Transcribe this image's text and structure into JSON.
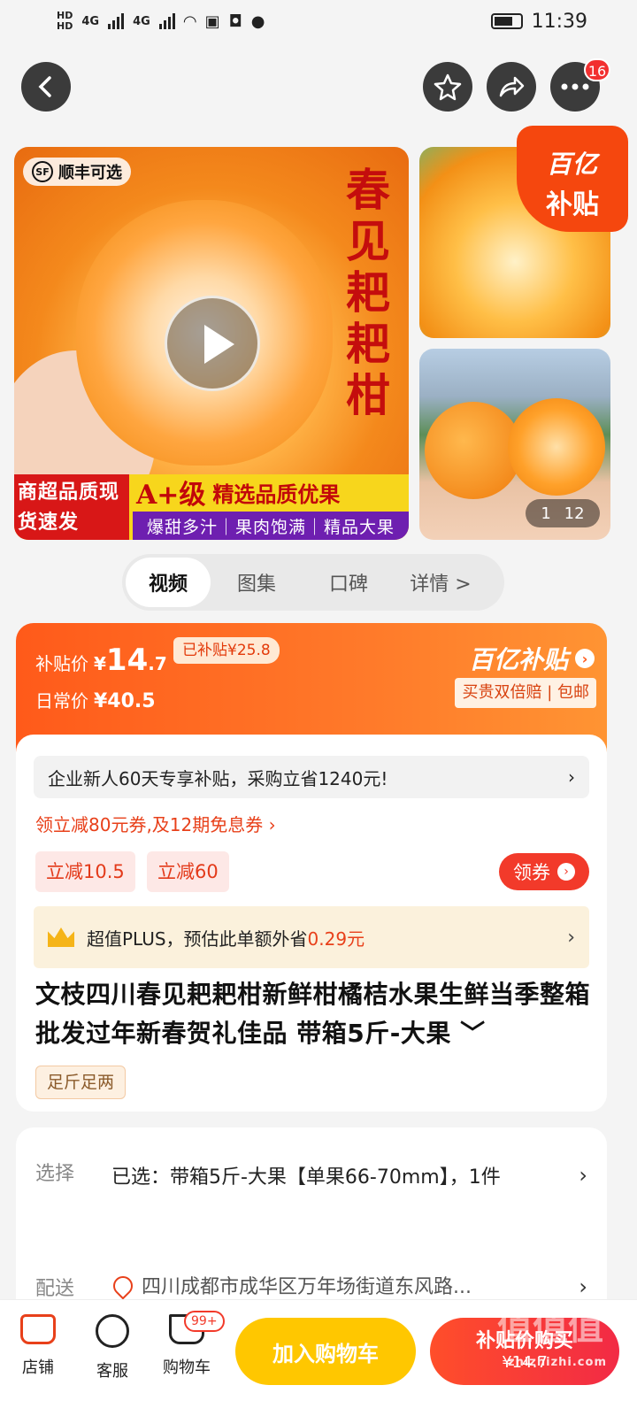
{
  "status_bar": {
    "time": "11:39",
    "network": "4G",
    "hd1": "HD",
    "hd2": "HD"
  },
  "nav": {
    "cart_badge": "16"
  },
  "gallery": {
    "sf_label": "顺丰可选",
    "sf_icon_text": "SF",
    "vertical_title": "春见耙耙柑",
    "banner_left": "商超品质现货速发",
    "banner_grade": "A+级",
    "banner_grade_text": "精选品质优果",
    "banner_bottom": "爆甜多汁｜果肉饱满｜精品大果",
    "subsidy_badge_l1": "百亿",
    "subsidy_badge_l2": "补贴",
    "counter_current": "1",
    "counter_total": "12"
  },
  "tabs": [
    {
      "label": "视频"
    },
    {
      "label": "图集"
    },
    {
      "label": "口碑"
    },
    {
      "label": "详情 >"
    }
  ],
  "price": {
    "subsidy_label": "补贴价",
    "currency": "¥",
    "subsidy_int": "14",
    "subsidy_dec": ".7",
    "subsidized_tag": "已补贴¥25.8",
    "regular_label": "日常价",
    "regular_price": "¥40.5",
    "brand": "百亿补贴",
    "promise": "买贵双倍赔 | 包邮"
  },
  "promo": {
    "new_user": "企业新人60天专享补贴，采购立省1240元!",
    "coupon_line": "领立减80元券,及12期免息券 ›",
    "chip1": "立减10.5",
    "chip2": "立减60",
    "get_coupon": "领券",
    "plus_text": "超值PLUS，预估此单额外省",
    "plus_amount": "0.29元"
  },
  "product": {
    "title": "文枝四川春见耙耙柑新鲜柑橘桔水果生鲜当季整箱批发过年新春贺礼佳品 带箱5斤-大果 ﹀",
    "tag": "足斤足两"
  },
  "options": {
    "select_label": "选择",
    "selected": "已选：带箱5斤-大果【单果66-70mm】，1件",
    "delivery_label": "配送",
    "address": "四川成都市成华区万年场街道东风路..."
  },
  "bottom_bar": {
    "store": "店铺",
    "service": "客服",
    "cart": "购物车",
    "cart_badge": "99+",
    "add_to_cart": "加入购物车",
    "buy_now": "补贴价购买",
    "buy_price": "¥14.7",
    "watermark": "zhizhizhi.com",
    "watermark2": "值值值"
  },
  "colors": {
    "accent": "#ff5a1a",
    "buy": "#f22a45",
    "cart": "#ffc700"
  }
}
